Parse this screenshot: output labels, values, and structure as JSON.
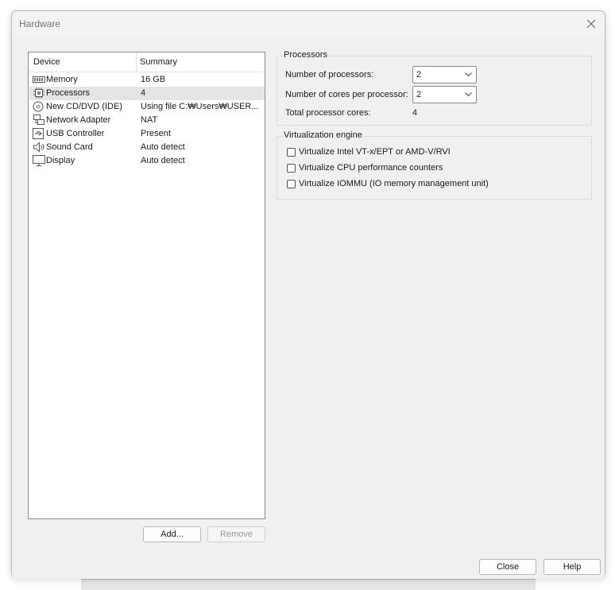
{
  "window": {
    "title": "Hardware"
  },
  "device_list": {
    "headers": {
      "device": "Device",
      "summary": "Summary"
    },
    "items": [
      {
        "icon": "memory-icon",
        "name": "Memory",
        "summary": "16 GB"
      },
      {
        "icon": "processor-icon",
        "name": "Processors",
        "summary": "4"
      },
      {
        "icon": "cd-dvd-icon",
        "name": "New CD/DVD (IDE)",
        "summary": "Using file C:₩Users₩USER..."
      },
      {
        "icon": "network-adapter-icon",
        "name": "Network Adapter",
        "summary": "NAT"
      },
      {
        "icon": "usb-icon",
        "name": "USB Controller",
        "summary": "Present"
      },
      {
        "icon": "sound-card-icon",
        "name": "Sound Card",
        "summary": "Auto detect"
      },
      {
        "icon": "display-icon",
        "name": "Display",
        "summary": "Auto detect"
      }
    ],
    "selected_index": 1
  },
  "list_buttons": {
    "add": "Add...",
    "remove": "Remove"
  },
  "processors": {
    "group_title": "Processors",
    "num_processors_label": "Number of processors:",
    "num_processors_value": "2",
    "cores_label": "Number of cores per processor:",
    "cores_value": "2",
    "total_label": "Total processor cores:",
    "total_value": "4"
  },
  "virtualization": {
    "group_title": "Virtualization engine",
    "options": [
      {
        "label": "Virtualize Intel VT-x/EPT or AMD-V/RVI",
        "checked": false
      },
      {
        "label": "Virtualize CPU performance counters",
        "checked": false
      },
      {
        "label": "Virtualize IOMMU (IO memory management unit)",
        "checked": false
      }
    ]
  },
  "footer": {
    "close": "Close",
    "help": "Help"
  }
}
